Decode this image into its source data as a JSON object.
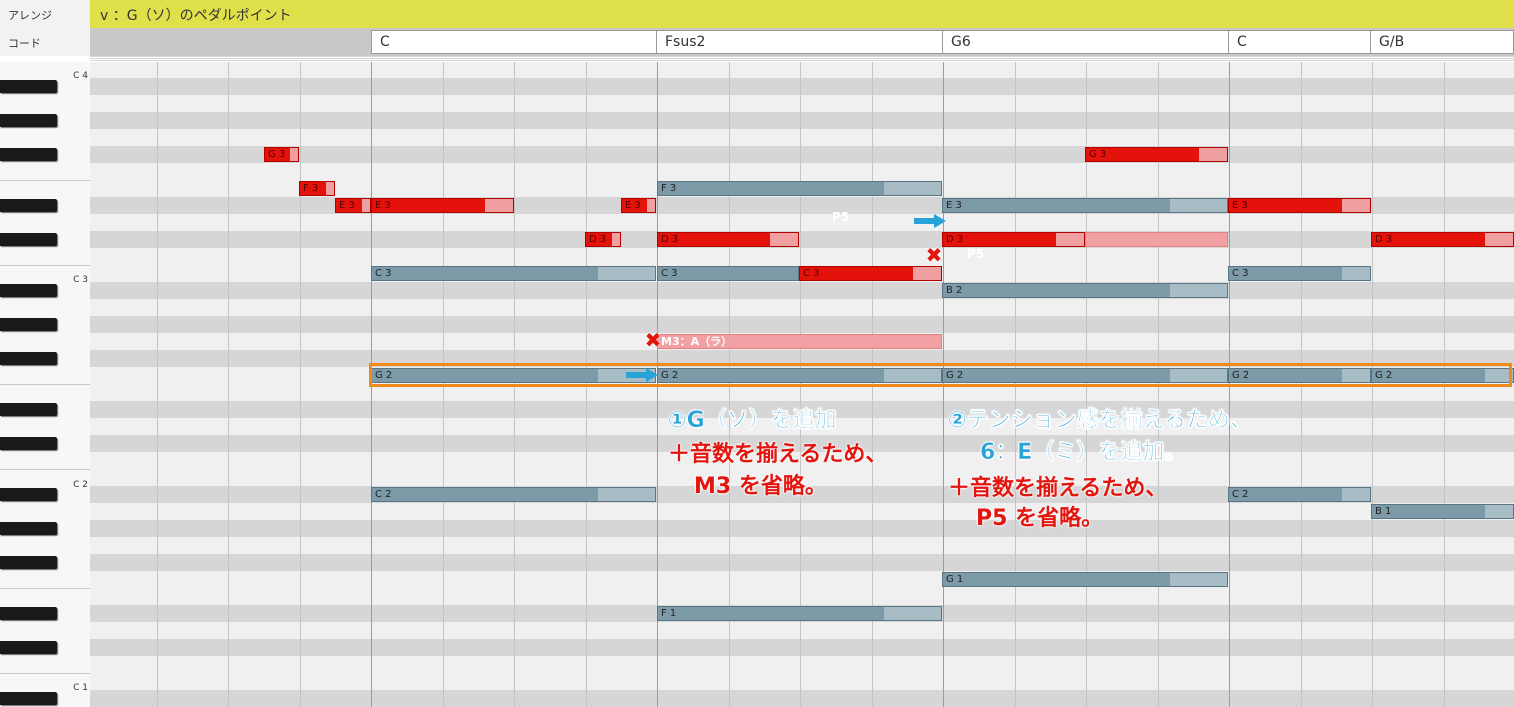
{
  "header": {
    "arrange_label": "アレンジ",
    "chord_label": "コード",
    "arrange_text": "v ：G（ソ）のペダルポイント"
  },
  "chords": [
    "C",
    "Fsus2",
    "G6",
    "C",
    "G/B"
  ],
  "octave_labels": [
    "C 4",
    "C 3",
    "C 2",
    "C 1"
  ],
  "notes": [
    {
      "label": "G 3",
      "color": "red"
    },
    {
      "label": "F 3",
      "color": "red"
    },
    {
      "label": "E 3",
      "color": "red"
    },
    {
      "label": "E 3",
      "color": "red"
    },
    {
      "label": "E 3",
      "color": "red"
    },
    {
      "label": "D 3",
      "color": "red"
    },
    {
      "label": "C 3",
      "color": "blue"
    },
    {
      "label": "G 2",
      "color": "blue"
    },
    {
      "label": "C 2",
      "color": "blue"
    },
    {
      "label": "F 3",
      "color": "blue"
    },
    {
      "label": "D 3",
      "color": "red"
    },
    {
      "label": "C 3",
      "color": "blue"
    },
    {
      "label": "C 3",
      "color": "red"
    },
    {
      "label": "M3：A（ラ）",
      "color": "pink"
    },
    {
      "label": "G 2",
      "color": "blue"
    },
    {
      "label": "F 1",
      "color": "blue"
    },
    {
      "label": "G 3",
      "color": "red"
    },
    {
      "label": "E 3",
      "color": "blue"
    },
    {
      "label": "D 3",
      "color": "red"
    },
    {
      "label": "",
      "color": "pink"
    },
    {
      "label": "B 2",
      "color": "blue"
    },
    {
      "label": "G 2",
      "color": "blue"
    },
    {
      "label": "G 1",
      "color": "blue"
    },
    {
      "label": "E 3",
      "color": "red"
    },
    {
      "label": "C 3",
      "color": "blue"
    },
    {
      "label": "G 2",
      "color": "blue"
    },
    {
      "label": "C 2",
      "color": "blue"
    },
    {
      "label": "D 3",
      "color": "red"
    },
    {
      "label": "G 2",
      "color": "blue"
    },
    {
      "label": "B 1",
      "color": "blue"
    }
  ],
  "floating_labels": {
    "p5_a": "P5",
    "p5_b": "P5"
  },
  "annotations": {
    "a1_line1": "①G（ソ）を追加",
    "a1_line2": "＋音数を揃えるため、",
    "a1_line3": "M3 を省略。",
    "a2_line1": "②テンション感を揃えるため、",
    "a2_line2": "6：E（ミ）を追加。",
    "a2_line3": "＋音数を揃えるため、",
    "a2_line4": "P5 を省略。"
  },
  "colors": {
    "arrange_bar": "#e0e04a",
    "note_red": "#e3120b",
    "note_blue": "#7c9aa8",
    "note_pink": "#f1a0a3",
    "highlight": "#f08a1c",
    "annotation_blue": "#27a3d8",
    "annotation_red": "#e3150f"
  },
  "icons": {
    "remove": "x-mark-icon",
    "add": "right-arrow-icon"
  }
}
